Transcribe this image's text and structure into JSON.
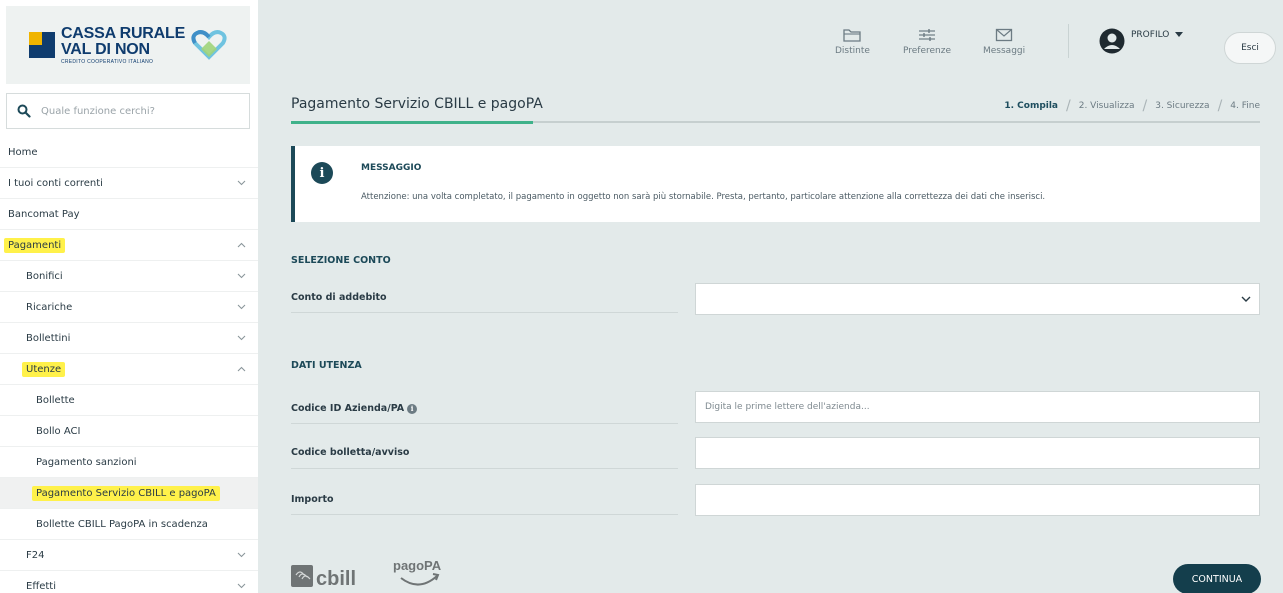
{
  "brand": {
    "line1": "CASSA RURALE",
    "line2": "VAL DI NON",
    "tagline": "CREDITO COOPERATIVO ITALIANO"
  },
  "search": {
    "placeholder": "Quale funzione cerchi?"
  },
  "menu": [
    {
      "label": "Home",
      "level": 0,
      "chevron": "none",
      "highlight": false,
      "active": false
    },
    {
      "label": "I tuoi conti correnti",
      "level": 0,
      "chevron": "down",
      "highlight": false,
      "active": false
    },
    {
      "label": "Bancomat Pay",
      "level": 0,
      "chevron": "none",
      "highlight": false,
      "active": false
    },
    {
      "label": "Pagamenti",
      "level": 0,
      "chevron": "up",
      "highlight": true,
      "active": false
    },
    {
      "label": "Bonifici",
      "level": 1,
      "chevron": "down",
      "highlight": false,
      "active": false
    },
    {
      "label": "Ricariche",
      "level": 1,
      "chevron": "down",
      "highlight": false,
      "active": false
    },
    {
      "label": "Bollettini",
      "level": 1,
      "chevron": "down",
      "highlight": false,
      "active": false
    },
    {
      "label": "Utenze",
      "level": 1,
      "chevron": "up",
      "highlight": true,
      "active": false
    },
    {
      "label": "Bollette",
      "level": 2,
      "chevron": "none",
      "highlight": false,
      "active": false
    },
    {
      "label": "Bollo ACI",
      "level": 2,
      "chevron": "none",
      "highlight": false,
      "active": false
    },
    {
      "label": "Pagamento sanzioni",
      "level": 2,
      "chevron": "none",
      "highlight": false,
      "active": false
    },
    {
      "label": "Pagamento Servizio CBILL e pagoPA",
      "level": 2,
      "chevron": "none",
      "highlight": true,
      "active": true
    },
    {
      "label": "Bollette CBILL PagoPA in scadenza",
      "level": 2,
      "chevron": "none",
      "highlight": false,
      "active": false
    },
    {
      "label": "F24",
      "level": 1,
      "chevron": "down",
      "highlight": false,
      "active": false
    },
    {
      "label": "Effetti",
      "level": 1,
      "chevron": "down",
      "highlight": false,
      "active": false
    }
  ],
  "topbar": {
    "distinte": "Distinte",
    "preferenze": "Preferenze",
    "messaggi": "Messaggi",
    "profile": "PROFILO",
    "logout": "Esci"
  },
  "page": {
    "title": "Pagamento Servizio CBILL e pagoPA",
    "progress_fraction": 0.25,
    "steps": [
      "1. Compila",
      "2. Visualizza",
      "3. Sicurezza",
      "4. Fine"
    ],
    "active_step": 0
  },
  "message": {
    "title": "MESSAGGIO",
    "text": "Attenzione: una volta completato, il pagamento in oggetto non sarà più stornabile. Presta, pertanto, particolare attenzione alla correttezza dei dati che inserisci."
  },
  "form": {
    "section_conto": "SELEZIONE CONTO",
    "conto_label": "Conto di addebito",
    "conto_value": "",
    "section_utenza": "DATI UTENZA",
    "codice_id_label": "Codice ID Azienda/PA",
    "codice_id_placeholder": "Digita le prime lettere dell'azienda...",
    "codice_bolletta_label": "Codice bolletta/avviso",
    "codice_bolletta_value": "",
    "importo_label": "Importo",
    "importo_value": ""
  },
  "footer": {
    "cbill": "cbill",
    "pagopa": "pagoPA",
    "continue": "CONTINUA"
  },
  "colors": {
    "primary": "#143e4c",
    "accent": "#3fb28a",
    "highlight": "#fff14a",
    "background": "#e3eaea"
  }
}
